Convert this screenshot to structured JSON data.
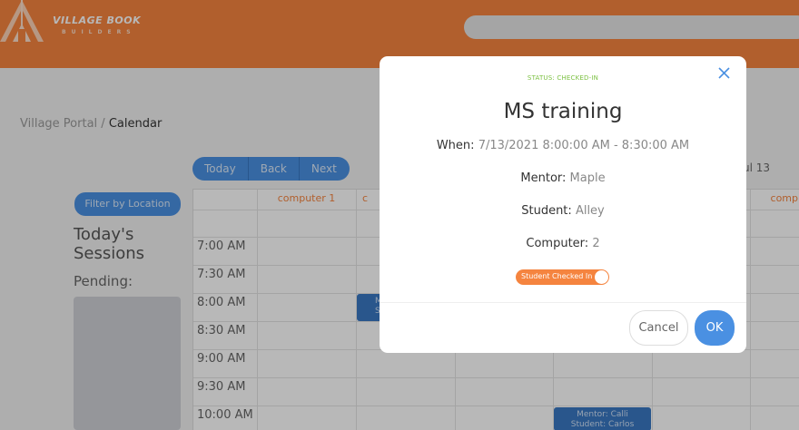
{
  "header": {
    "logo_title": "VILLAGE BOOK",
    "logo_subtitle": "BUILDERS",
    "brand_color": "#f5843f"
  },
  "breadcrumb": {
    "root": "Village Portal",
    "separator": "/",
    "current": "Calendar"
  },
  "toolbar": {
    "today": "Today",
    "back": "Back",
    "next": "Next",
    "date_label": "ul 13"
  },
  "sidebar": {
    "filter_label": "Filter by Location",
    "sessions_title_line1": "Today's",
    "sessions_title_line2": "Sessions",
    "pending_label": "Pending:"
  },
  "calendar": {
    "columns": [
      "computer 1",
      "c",
      "",
      "",
      "",
      "comp"
    ],
    "times": [
      "7:00 AM",
      "7:30 AM",
      "8:00 AM",
      "8:30 AM",
      "9:00 AM",
      "9:30 AM",
      "10:00 AM"
    ],
    "events": [
      {
        "line1": "M",
        "line2": "S"
      },
      {
        "line1": "Mentor: Calli",
        "line2": "Student: Carlos"
      }
    ]
  },
  "modal": {
    "status": "STATUS: CHECKED-IN",
    "title": "MS training",
    "when_label": "When:",
    "when_value": "7/13/2021 8:00:00 AM - 8:30:00 AM",
    "mentor_label": "Mentor:",
    "mentor_value": "Maple",
    "student_label": "Student:",
    "student_value": "Alley",
    "computer_label": "Computer:",
    "computer_value": "2",
    "toggle_label": "Student Checked In",
    "toggle_on": true,
    "close_icon": "close-icon",
    "cancel_label": "Cancel",
    "ok_label": "OK",
    "status_color": "#7cc142",
    "accent": "#4a90e2"
  }
}
